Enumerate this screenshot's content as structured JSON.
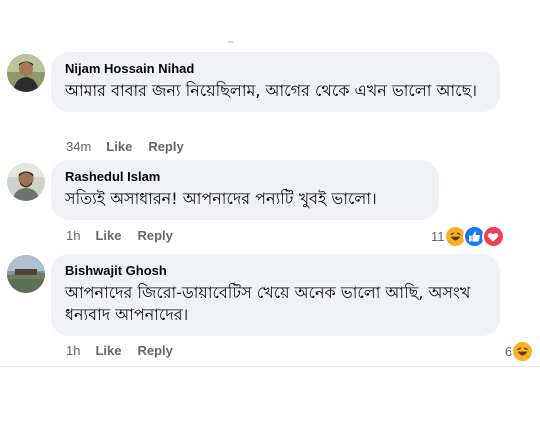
{
  "comments": [
    {
      "author": "Nijam Hossain Nihad",
      "text": "আমার বাবার জন্য নিয়েছিলাম, আগের থেকে এখন ভালো আছে।",
      "time": "34m",
      "like_label": "Like",
      "reply_label": "Reply"
    },
    {
      "author": "Rashedul Islam",
      "text": "সত্যিই অসাধারন! আপনাদের পন্যটি খুবই ভালো।",
      "time": "1h",
      "like_label": "Like",
      "reply_label": "Reply",
      "reaction_count": "11",
      "reactions": [
        "haha-icon",
        "like-icon",
        "love-icon"
      ]
    },
    {
      "author": "Bishwajit Ghosh",
      "text": "আপনাদের জিরো-ডায়াবেটিস খেয়ে অনেক ভালো আছি, অসংখ ধন্যবাদ আপনাদের।",
      "time": "1h",
      "like_label": "Like",
      "reply_label": "Reply",
      "reaction_count": "6",
      "reactions": [
        "haha-icon"
      ]
    }
  ],
  "colors": {
    "bubble_bg": "#f0f2f5",
    "meta_text": "#65676b",
    "like_blue": "#1877f2",
    "love_red": "#f33e58",
    "haha_yellow": "#f7b125"
  }
}
